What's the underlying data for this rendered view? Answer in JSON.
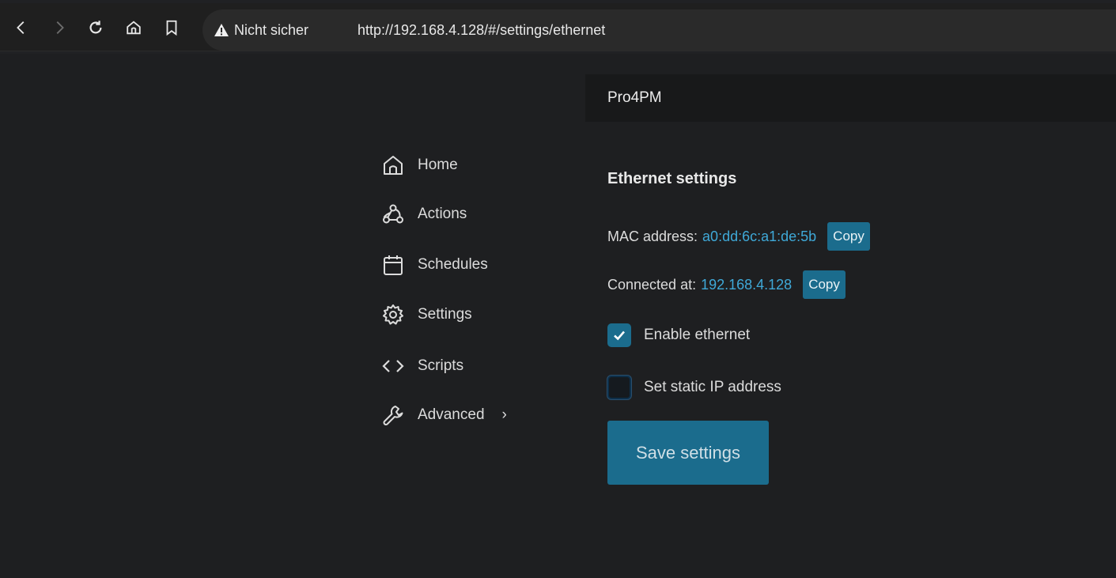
{
  "browser": {
    "security_label": "Nicht sicher",
    "url": "http://192.168.4.128/#/settings/ethernet"
  },
  "header": {
    "device_name": "Pro4PM"
  },
  "sidebar": {
    "items": [
      {
        "label": "Home",
        "icon": "home-icon"
      },
      {
        "label": "Actions",
        "icon": "webhook-icon"
      },
      {
        "label": "Schedules",
        "icon": "calendar-icon"
      },
      {
        "label": "Settings",
        "icon": "gear-icon"
      },
      {
        "label": "Scripts",
        "icon": "code-icon"
      },
      {
        "label": "Advanced",
        "icon": "wrench-icon"
      }
    ],
    "advanced_chevron": "›"
  },
  "main": {
    "title": "Ethernet settings",
    "mac_label": "MAC address:",
    "mac_value": "a0:dd:6c:a1:de:5b",
    "ip_label": "Connected at:",
    "ip_value": "192.168.4.128",
    "copy_label": "Copy",
    "enable_ethernet_label": "Enable ethernet",
    "enable_ethernet_checked": true,
    "static_ip_label": "Set static IP address",
    "static_ip_checked": false,
    "save_label": "Save settings"
  },
  "colors": {
    "accent": "#1b6c8d",
    "link": "#3fa9d8",
    "background": "#1e1f21"
  }
}
